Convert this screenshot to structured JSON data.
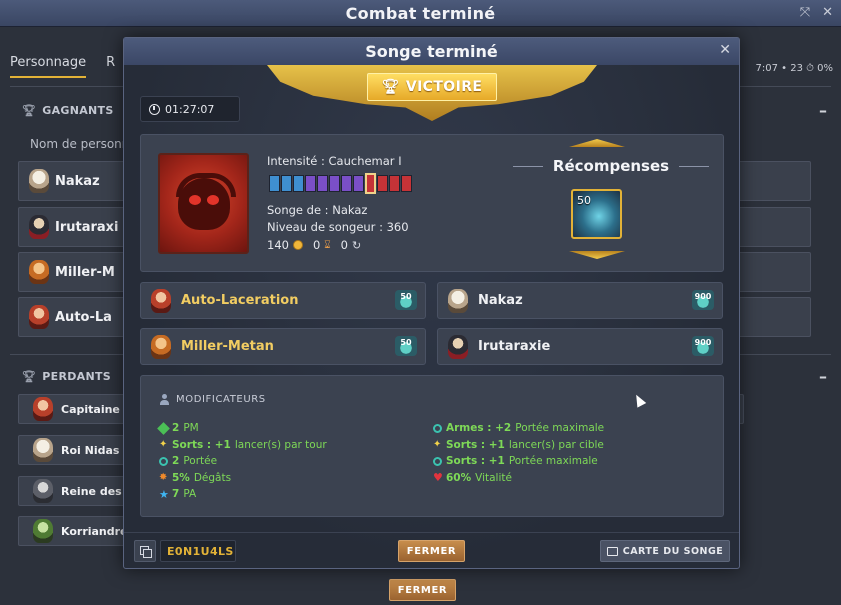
{
  "window": {
    "title": "Combat terminé"
  },
  "background": {
    "tabs": [
      "Personnage",
      "R"
    ],
    "stats": "7:07 • 23 ⏱ 0%",
    "winners": {
      "title": "GAGNANTS",
      "column_header": "Nom de personn",
      "players": [
        "Nakaz",
        "Irutaraxi",
        "Miller-M",
        "Auto-La"
      ]
    },
    "losers": {
      "title": "PERDANTS",
      "players": [
        "Capitaine I",
        "Roi Nidas",
        "Reine des V",
        "Korriandre"
      ]
    },
    "close_label": "FERMER"
  },
  "modal": {
    "title": "Songe terminé",
    "result": "VICTOIRE",
    "duration": "01:27:07",
    "dream": {
      "intensity": "Intensité : Cauchemar I",
      "owner": "Songe de : Nakaz",
      "level": "Niveau de songeur : 360",
      "coins": "140",
      "hourglass": "0",
      "cycles": "0",
      "intensity_segments": [
        "blue",
        "blue",
        "blue",
        "purple",
        "purple",
        "purple",
        "purple",
        "purple",
        "current",
        "red",
        "red",
        "red"
      ]
    },
    "rewards": {
      "title": "Récompenses",
      "quantity": "50"
    },
    "players": [
      {
        "name": "Auto-Laceration",
        "highlight": true,
        "badge": "50"
      },
      {
        "name": "Nakaz",
        "highlight": false,
        "badge": "900"
      },
      {
        "name": "Miller-Metan",
        "highlight": true,
        "badge": "50"
      },
      {
        "name": "Irutaraxie",
        "highlight": false,
        "badge": "900"
      }
    ],
    "modifiers": {
      "title": "MODIFICATEURS",
      "left": [
        {
          "icon": "pm-icon",
          "label": "2",
          "rest": "PM"
        },
        {
          "icon": "spark-icon",
          "label": "Sorts : +1",
          "rest": "lancer(s) par tour"
        },
        {
          "icon": "eye-icon",
          "label": "2",
          "rest": "Portée"
        },
        {
          "icon": "fire-icon",
          "label": "5%",
          "rest": "Dégâts"
        },
        {
          "icon": "star-icon",
          "label": "7",
          "rest": "PA"
        }
      ],
      "right": [
        {
          "icon": "eye-icon",
          "label": "Armes : +2",
          "rest": "Portée maximale"
        },
        {
          "icon": "spark-icon",
          "label": "Sorts : +1",
          "rest": "lancer(s) par cible"
        },
        {
          "icon": "eye-icon",
          "label": "Sorts : +1",
          "rest": "Portée maximale"
        },
        {
          "icon": "heart-icon",
          "label": "60%",
          "rest": "Vitalité"
        }
      ]
    },
    "footer": {
      "code": "E0N1U4LS",
      "close_label": "FERMER",
      "map_label": "CARTE DU SONGE"
    }
  },
  "colors": {
    "gold": "#e2b237",
    "green_mod": "#7ed957",
    "panel": "#3b4250"
  }
}
